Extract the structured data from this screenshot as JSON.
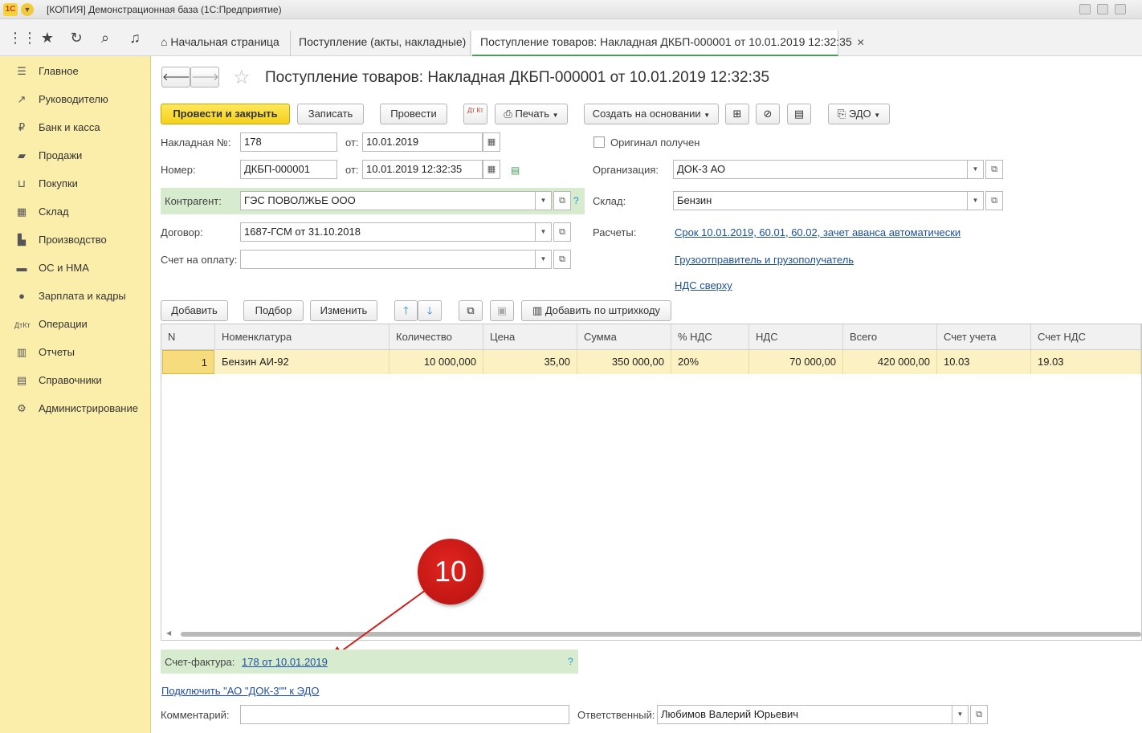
{
  "window": {
    "title": "[КОПИЯ] Демонстрационная база (1С:Предприятие)",
    "logo": "1С"
  },
  "tabs": [
    {
      "label": "Начальная страница"
    },
    {
      "label": "Поступление (акты, накладные)"
    },
    {
      "label": "Поступление товаров: Накладная ДКБП-000001 от 10.01.2019 12:32:35"
    }
  ],
  "sidebar": {
    "items": [
      {
        "label": "Главное",
        "icon": "menu-icon"
      },
      {
        "label": "Руководителю",
        "icon": "trend-icon"
      },
      {
        "label": "Банк и касса",
        "icon": "ruble-icon"
      },
      {
        "label": "Продажи",
        "icon": "bag-icon"
      },
      {
        "label": "Покупки",
        "icon": "cart-icon"
      },
      {
        "label": "Склад",
        "icon": "warehouse-icon"
      },
      {
        "label": "Производство",
        "icon": "factory-icon"
      },
      {
        "label": "ОС и НМА",
        "icon": "truck-icon"
      },
      {
        "label": "Зарплата и кадры",
        "icon": "person-icon"
      },
      {
        "label": "Операции",
        "icon": "dtkt-icon"
      },
      {
        "label": "Отчеты",
        "icon": "chart-icon"
      },
      {
        "label": "Справочники",
        "icon": "book-icon"
      },
      {
        "label": "Администрирование",
        "icon": "gear-icon"
      }
    ]
  },
  "doc": {
    "title": "Поступление товаров: Накладная ДКБП-000001 от 10.01.2019 12:32:35",
    "toolbar": {
      "post_close": "Провести и закрыть",
      "save": "Записать",
      "post": "Провести",
      "dtkt": "Дт Кт",
      "print": "Печать",
      "create_based": "Создать на основании",
      "edo": "ЭДО"
    },
    "fields": {
      "invoice_no_label": "Накладная №:",
      "invoice_no": "178",
      "from_label": "от:",
      "invoice_date": "10.01.2019",
      "number_label": "Номер:",
      "number": "ДКБП-000001",
      "number_date": "10.01.2019 12:32:35",
      "original_label": "Оригинал получен",
      "org_label": "Организация:",
      "org": "ДОК-3 АО",
      "counterparty_label": "Контрагент:",
      "counterparty": "ГЭС ПОВОЛЖЬЕ ООО",
      "warehouse_label": "Склад:",
      "warehouse": "Бензин",
      "contract_label": "Договор:",
      "contract": "1687-ГСМ от 31.10.2018",
      "settlements_label": "Расчеты:",
      "settlements_link": "Срок 10.01.2019, 60.01, 60.02, зачет аванса автоматически",
      "payment_label": "Счет на оплату:",
      "payment": "",
      "shipper_link": "Грузоотправитель и грузополучатель",
      "vat_link": "НДС сверху",
      "help": "?"
    },
    "table_toolbar": {
      "add": "Добавить",
      "pick": "Подбор",
      "change": "Изменить",
      "barcode": "Добавить по штрихкоду"
    },
    "table": {
      "columns": [
        "N",
        "Номенклатура",
        "Количество",
        "Цена",
        "Сумма",
        "% НДС",
        "НДС",
        "Всего",
        "Счет учета",
        "Счет НДС"
      ],
      "rows": [
        [
          "1",
          "Бензин АИ-92",
          "10 000,000",
          "35,00",
          "350 000,00",
          "20%",
          "70 000,00",
          "420 000,00",
          "10.03",
          "19.03"
        ]
      ]
    },
    "footer": {
      "invoice_label": "Счет-фактура:",
      "invoice_link": "178 от 10.01.2019",
      "help": "?",
      "edo_link": "Подключить \"АО \"ДОК-3\"\" к ЭДО",
      "comment_label": "Комментарий:",
      "comment": "",
      "responsible_label": "Ответственный:",
      "responsible": "Любимов Валерий Юрьевич"
    },
    "callout": "10"
  }
}
